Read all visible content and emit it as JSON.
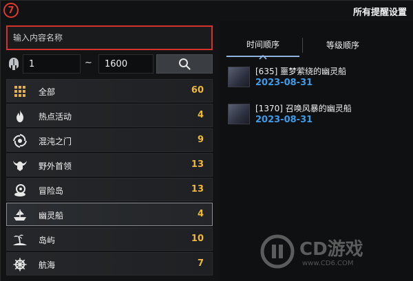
{
  "header": {
    "step_number": "7",
    "title": "所有提醒设置"
  },
  "search": {
    "placeholder": "输入内容名称"
  },
  "range": {
    "min": "1",
    "separator": "~",
    "max": "1600"
  },
  "categories": [
    {
      "label": "全部",
      "count": "60",
      "icon": "grid-icon"
    },
    {
      "label": "热点活动",
      "count": "4",
      "icon": "fire-icon"
    },
    {
      "label": "混沌之门",
      "count": "9",
      "icon": "vortex-icon"
    },
    {
      "label": "野外首领",
      "count": "13",
      "icon": "horned-helmet-icon"
    },
    {
      "label": "冒险岛",
      "count": "13",
      "icon": "island-compass-icon"
    },
    {
      "label": "幽灵船",
      "count": "4",
      "icon": "ghost-ship-icon"
    },
    {
      "label": "岛屿",
      "count": "10",
      "icon": "palm-island-icon"
    },
    {
      "label": "航海",
      "count": "7",
      "icon": "ship-wheel-icon"
    }
  ],
  "tabs": {
    "time_order": "时间顺序",
    "level_order": "等级顺序"
  },
  "quests": [
    {
      "title": "[635] 噩梦萦绕的幽灵船",
      "date": "2023-08-31"
    },
    {
      "title": "[1370] 召唤风暴的幽灵船",
      "date": "2023-08-31"
    }
  ],
  "watermark": {
    "text": "CD游戏",
    "url": "www.CD6.COM"
  },
  "colors": {
    "highlight_border": "#d8322c",
    "count_gold": "#f0b93a",
    "date_blue": "#3d9be8",
    "tab_accent": "#8fb6e0"
  }
}
